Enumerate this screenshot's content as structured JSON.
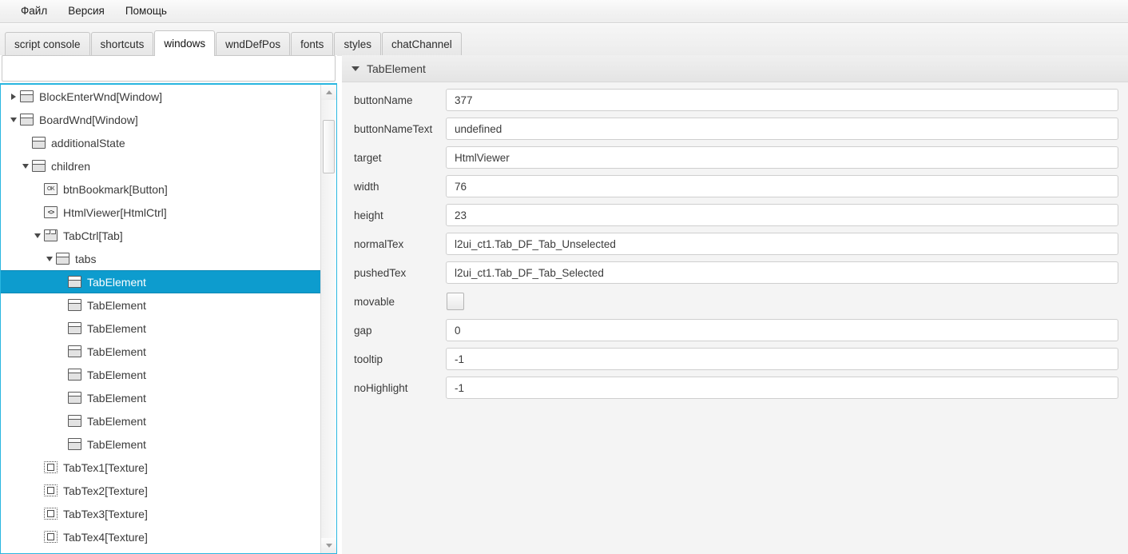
{
  "menubar": {
    "items": [
      {
        "label": "Файл",
        "name": "menu-file"
      },
      {
        "label": "Версия",
        "name": "menu-version"
      },
      {
        "label": "Помощь",
        "name": "menu-help"
      }
    ]
  },
  "tabstrip": {
    "tabs": [
      {
        "label": "script console",
        "selected": false
      },
      {
        "label": "shortcuts",
        "selected": false
      },
      {
        "label": "windows",
        "selected": true
      },
      {
        "label": "wndDefPos",
        "selected": false
      },
      {
        "label": "fonts",
        "selected": false
      },
      {
        "label": "styles",
        "selected": false
      },
      {
        "label": "chatChannel",
        "selected": false
      }
    ]
  },
  "left_panel": {
    "filter_input": {
      "value": "",
      "placeholder": ""
    },
    "accent_color": "#29b6e0",
    "selection_color": "#0d9cce",
    "tree": [
      {
        "label": "BlockEnterWnd[Window]",
        "depth": 0,
        "icon": "window-icon",
        "expander": "collapsed",
        "selected": false
      },
      {
        "label": "BoardWnd[Window]",
        "depth": 0,
        "icon": "window-icon",
        "expander": "expanded",
        "selected": false
      },
      {
        "label": "additionalState",
        "depth": 1,
        "icon": "window-icon",
        "expander": "none",
        "selected": false
      },
      {
        "label": "children",
        "depth": 1,
        "icon": "window-icon",
        "expander": "expanded",
        "selected": false
      },
      {
        "label": "btnBookmark[Button]",
        "depth": 2,
        "icon": "button-icon",
        "expander": "none",
        "selected": false
      },
      {
        "label": "HtmlViewer[HtmlCtrl]",
        "depth": 2,
        "icon": "html-icon",
        "expander": "none",
        "selected": false
      },
      {
        "label": "TabCtrl[Tab]",
        "depth": 2,
        "icon": "tab-icon",
        "expander": "expanded",
        "selected": false
      },
      {
        "label": "tabs",
        "depth": 3,
        "icon": "window-icon",
        "expander": "expanded",
        "selected": false
      },
      {
        "label": "TabElement",
        "depth": 4,
        "icon": "window-icon",
        "expander": "none",
        "selected": true
      },
      {
        "label": "TabElement",
        "depth": 4,
        "icon": "window-icon",
        "expander": "none",
        "selected": false
      },
      {
        "label": "TabElement",
        "depth": 4,
        "icon": "window-icon",
        "expander": "none",
        "selected": false
      },
      {
        "label": "TabElement",
        "depth": 4,
        "icon": "window-icon",
        "expander": "none",
        "selected": false
      },
      {
        "label": "TabElement",
        "depth": 4,
        "icon": "window-icon",
        "expander": "none",
        "selected": false
      },
      {
        "label": "TabElement",
        "depth": 4,
        "icon": "window-icon",
        "expander": "none",
        "selected": false
      },
      {
        "label": "TabElement",
        "depth": 4,
        "icon": "window-icon",
        "expander": "none",
        "selected": false
      },
      {
        "label": "TabElement",
        "depth": 4,
        "icon": "window-icon",
        "expander": "none",
        "selected": false
      },
      {
        "label": "TabTex1[Texture]",
        "depth": 2,
        "icon": "texture-icon",
        "expander": "none",
        "selected": false
      },
      {
        "label": "TabTex2[Texture]",
        "depth": 2,
        "icon": "texture-icon",
        "expander": "none",
        "selected": false
      },
      {
        "label": "TabTex3[Texture]",
        "depth": 2,
        "icon": "texture-icon",
        "expander": "none",
        "selected": false
      },
      {
        "label": "TabTex4[Texture]",
        "depth": 2,
        "icon": "texture-icon",
        "expander": "none",
        "selected": false
      }
    ],
    "scrollbar": {
      "up_arrow": "▲",
      "down_arrow": "▼"
    }
  },
  "right_panel": {
    "header": {
      "title": "TabElement",
      "expander": "expanded"
    },
    "properties": [
      {
        "label": "buttonName",
        "value": "377",
        "type": "text"
      },
      {
        "label": "buttonNameText",
        "value": "undefined",
        "type": "text"
      },
      {
        "label": "target",
        "value": "HtmlViewer",
        "type": "text"
      },
      {
        "label": "width",
        "value": "76",
        "type": "text"
      },
      {
        "label": "height",
        "value": "23",
        "type": "text"
      },
      {
        "label": "normalTex",
        "value": "l2ui_ct1.Tab_DF_Tab_Unselected",
        "type": "text"
      },
      {
        "label": "pushedTex",
        "value": "l2ui_ct1.Tab_DF_Tab_Selected",
        "type": "text"
      },
      {
        "label": "movable",
        "value": "",
        "type": "checkbox",
        "checked": false
      },
      {
        "label": "gap",
        "value": "0",
        "type": "text"
      },
      {
        "label": "tooltip",
        "value": "-1",
        "type": "text"
      },
      {
        "label": "noHighlight",
        "value": "-1",
        "type": "text"
      }
    ]
  }
}
